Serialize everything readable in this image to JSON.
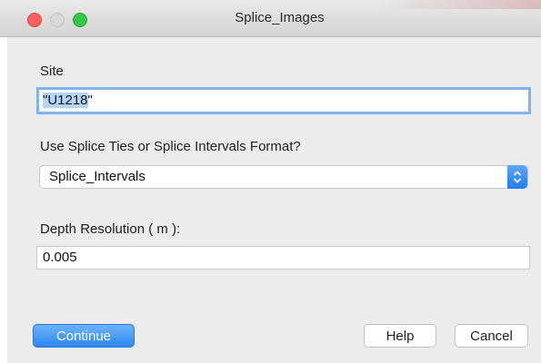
{
  "window": {
    "title": "Splice_Images"
  },
  "form": {
    "site": {
      "label": "Site",
      "value": "\"U1218\"",
      "value_selected": "\"U1218",
      "value_rest": "\""
    },
    "format": {
      "label": "Use Splice Ties or Splice Intervals Format?",
      "selected": "Splice_Intervals"
    },
    "depth": {
      "label": "Depth Resolution ( m ):",
      "value": "0.005"
    }
  },
  "buttons": {
    "continue": "Continue",
    "help": "Help",
    "cancel": "Cancel"
  },
  "colors": {
    "accent": "#2e86f1",
    "close": "#fc605c",
    "maximize": "#34c84a",
    "selection": "#b4d5fe"
  }
}
